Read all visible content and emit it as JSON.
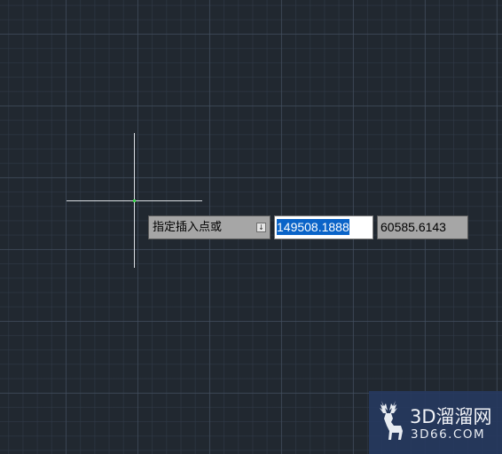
{
  "prompt": {
    "label": "指定插入点或",
    "dropdown_icon": "down-arrow-icon"
  },
  "coordinates": {
    "x_value": "149508.1888",
    "y_value": "60585.6143"
  },
  "cursor": {
    "icon": "crosshair-cursor-icon",
    "color": "#d9dde2",
    "center_color": "#3ad24a"
  },
  "watermark": {
    "name": "3D溜溜网",
    "url": "3D66.COM",
    "logo_icon": "deer-icon"
  },
  "colors": {
    "background": "#212830",
    "selection": "#0a64c8"
  }
}
